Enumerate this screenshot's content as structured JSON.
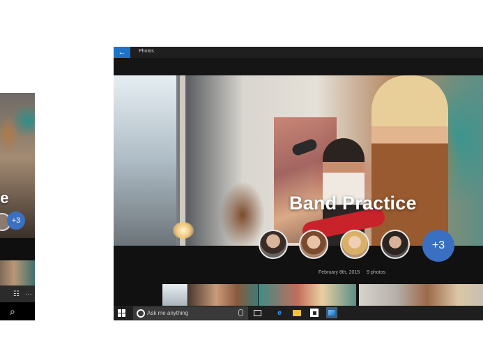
{
  "phone": {
    "album_title": "ce",
    "more_count": "+3",
    "toolbar_list_glyph": "☷",
    "toolbar_more_glyph": "···",
    "search_glyph": "⌕"
  },
  "window": {
    "back_glyph": "←",
    "app_title": "Photos",
    "album": {
      "title": "Band Practice",
      "date": "February 8th, 2015",
      "count": "9 photos",
      "more_people": "+3"
    }
  },
  "taskbar": {
    "search_placeholder": "Ask me anything",
    "edge_glyph": "e"
  },
  "colors": {
    "accent": "#1e73c8",
    "more_button": "#3b6fc2",
    "chrome": "#1b1b1b"
  }
}
